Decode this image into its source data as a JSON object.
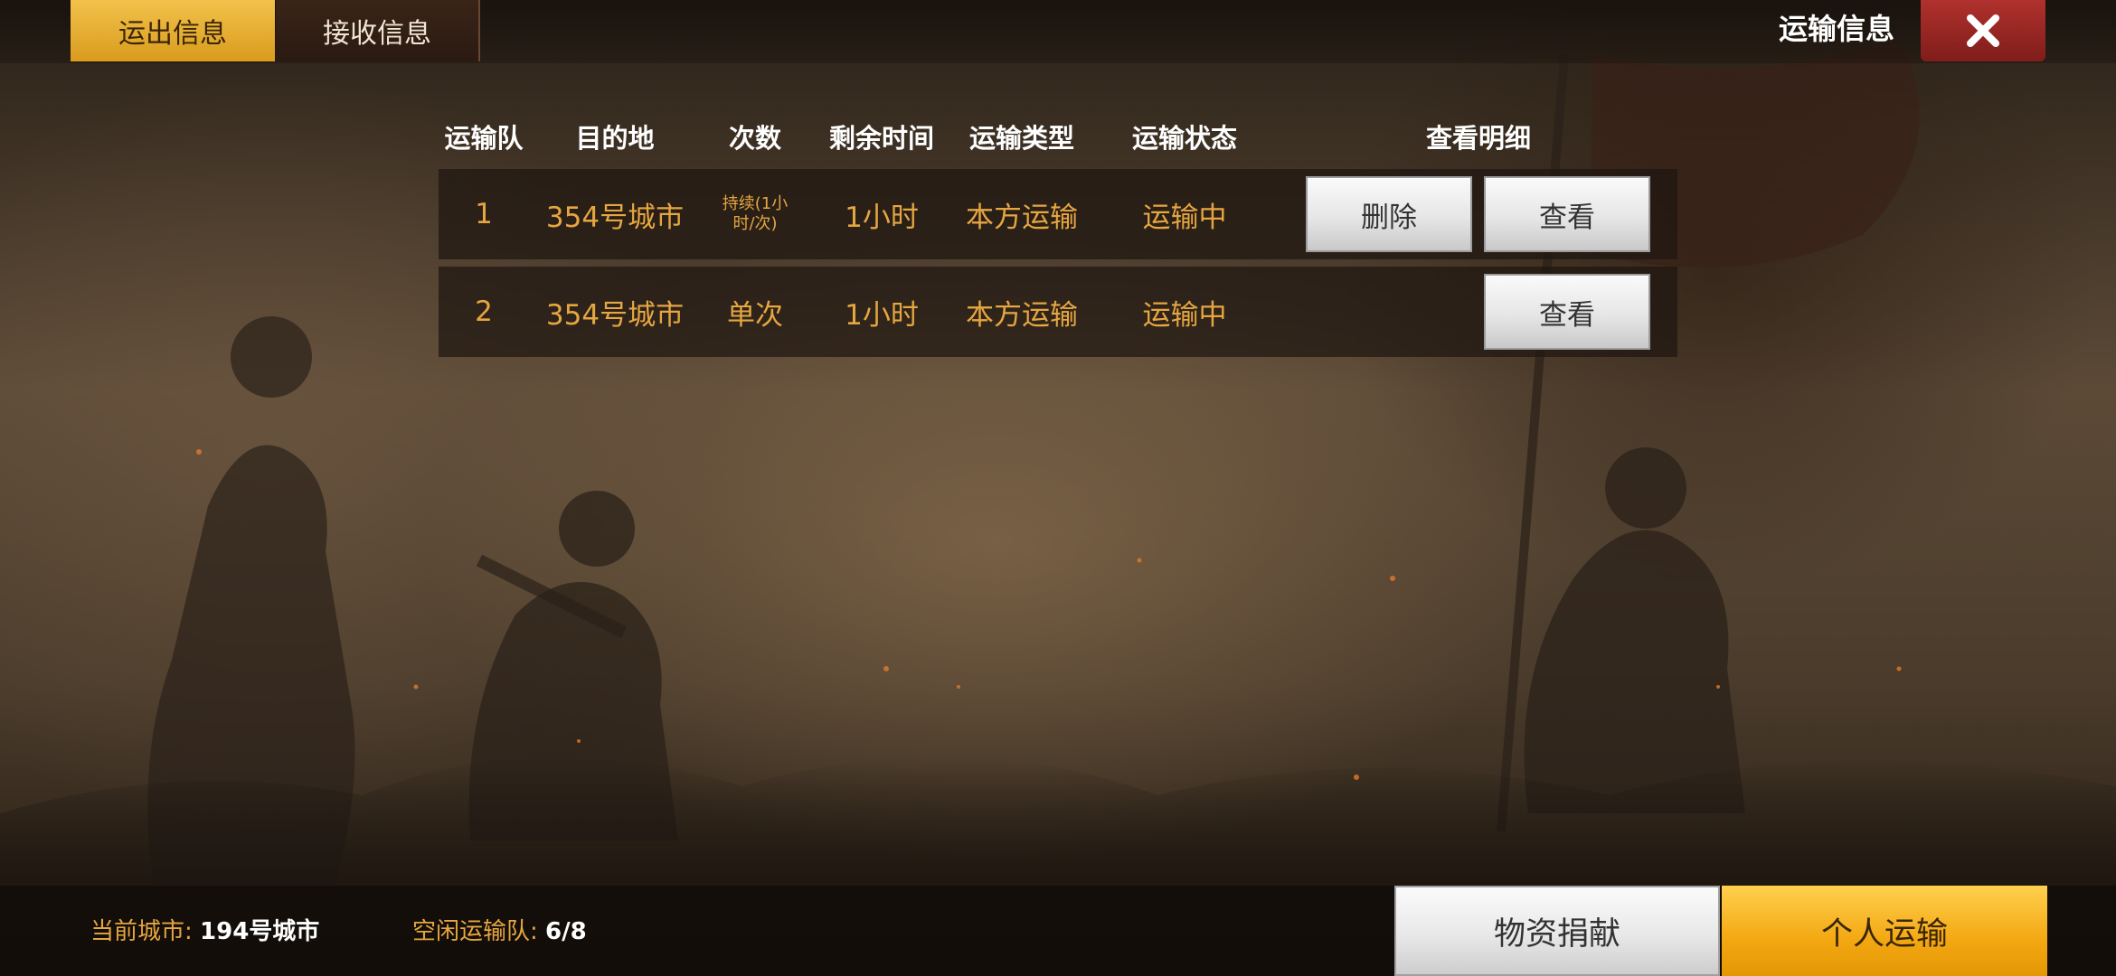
{
  "tabs": [
    {
      "label": "运出信息",
      "active": true
    },
    {
      "label": "接收信息",
      "active": false
    }
  ],
  "window_title": "运输信息",
  "table": {
    "headers": {
      "team": "运输队",
      "destination": "目的地",
      "count": "次数",
      "remaining_time": "剩余时间",
      "transport_type": "运输类型",
      "transport_status": "运输状态",
      "detail": "查看明细"
    },
    "rows": [
      {
        "team": "1",
        "destination": "354号城市",
        "count": "持续(1小时/次)",
        "remaining_time": "1小时",
        "transport_type": "本方运输",
        "transport_status": "运输中",
        "delete_label": "删除",
        "view_label": "查看"
      },
      {
        "team": "2",
        "destination": "354号城市",
        "count": "单次",
        "remaining_time": "1小时",
        "transport_type": "本方运输",
        "transport_status": "运输中",
        "view_label": "查看"
      }
    ]
  },
  "footer": {
    "current_city_label": "当前城市:",
    "current_city_value": "194号城市",
    "idle_teams_label": "空闲运输队:",
    "idle_teams_value": "6/8",
    "donate_label": "物资捐献",
    "personal_label": "个人运输"
  },
  "icons": {
    "close": "close-icon"
  },
  "colors": {
    "accent_gold": "#e6a640",
    "tab_active": "#f3c24a",
    "close_red": "#b0312d"
  }
}
